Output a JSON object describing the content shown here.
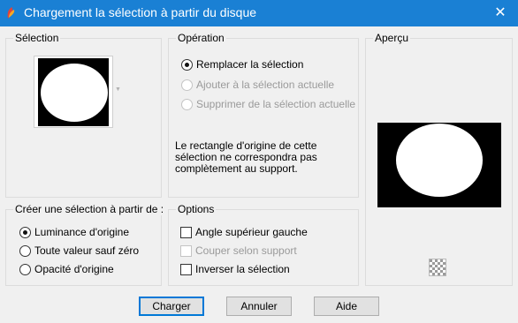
{
  "window": {
    "title": "Chargement la sélection à partir du disque",
    "close_glyph": "✕",
    "accent_color": "#1a80d4"
  },
  "selection_group": {
    "title": "Sélection"
  },
  "operation_group": {
    "title": "Opération",
    "options": [
      {
        "label": "Remplacer la sélection",
        "checked": true,
        "enabled": true
      },
      {
        "label": "Ajouter à la sélection actuelle",
        "checked": false,
        "enabled": false
      },
      {
        "label": "Supprimer de la sélection actuelle",
        "checked": false,
        "enabled": false
      }
    ],
    "note_lines": [
      "Le rectangle d'origine de cette",
      "sélection ne correspondra pas",
      "complètement au support."
    ]
  },
  "preview_group": {
    "title": "Aperçu"
  },
  "create_group": {
    "title": "Créer une sélection à partir de :",
    "options": [
      {
        "label": "Luminance d'origine",
        "checked": true
      },
      {
        "label": "Toute valeur sauf zéro",
        "checked": false
      },
      {
        "label": "Opacité d'origine",
        "checked": false
      }
    ]
  },
  "options_group": {
    "title": "Options",
    "checkboxes": [
      {
        "label": "Angle supérieur gauche",
        "checked": false,
        "enabled": true
      },
      {
        "label": "Couper selon support",
        "checked": false,
        "enabled": false
      },
      {
        "label": "Inverser la sélection",
        "checked": false,
        "enabled": true
      }
    ]
  },
  "buttons": {
    "ok": "Charger",
    "cancel": "Annuler",
    "help": "Aide"
  }
}
